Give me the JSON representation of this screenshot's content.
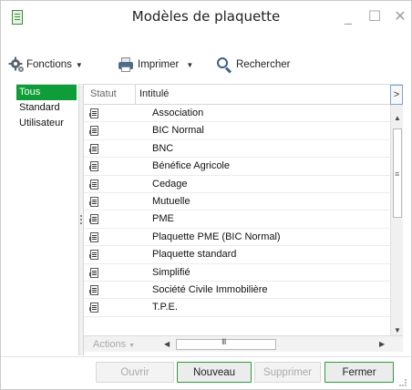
{
  "window": {
    "title": "Modèles de plaquette",
    "minimize_glyph": "_",
    "maximize_glyph": "☐",
    "close_glyph": "✕"
  },
  "toolbar": {
    "functions_label": "Fonctions",
    "print_label": "Imprimer",
    "search_label": "Rechercher",
    "functions_icon": "gear-icon",
    "print_icon": "printer-icon",
    "search_icon": "magnifier-icon"
  },
  "filters": {
    "items": [
      {
        "label": "Tous",
        "selected": true
      },
      {
        "label": "Standard",
        "selected": false
      },
      {
        "label": "Utilisateur",
        "selected": false
      }
    ]
  },
  "grid": {
    "columns": {
      "status": "Statut",
      "title": "Intitulé"
    },
    "header_button": ">",
    "rows": [
      "Association",
      "BIC Normal",
      "BNC",
      "Bénéfice Agricole",
      "Cedage",
      "Mutuelle",
      "PME",
      "Plaquette PME (BIC Normal)",
      "Plaquette standard",
      "Simplifié",
      "Société Civile Immobilière",
      "T.P.E."
    ],
    "row_status_icon": "document-icon",
    "actions_label": "Actions",
    "scroll_up": "▲",
    "scroll_down": "▼",
    "scroll_left": "◀",
    "scroll_right": "▶",
    "scroll_grip_v": "≡",
    "scroll_grip_h": "III"
  },
  "buttons": {
    "open": "Ouvrir",
    "new": "Nouveau",
    "delete": "Supprimer",
    "close": "Fermer"
  },
  "colors": {
    "accent_green": "#0f9d3a",
    "button_border_green": "#2d9b3c",
    "disabled_text": "#aaaaaa"
  }
}
